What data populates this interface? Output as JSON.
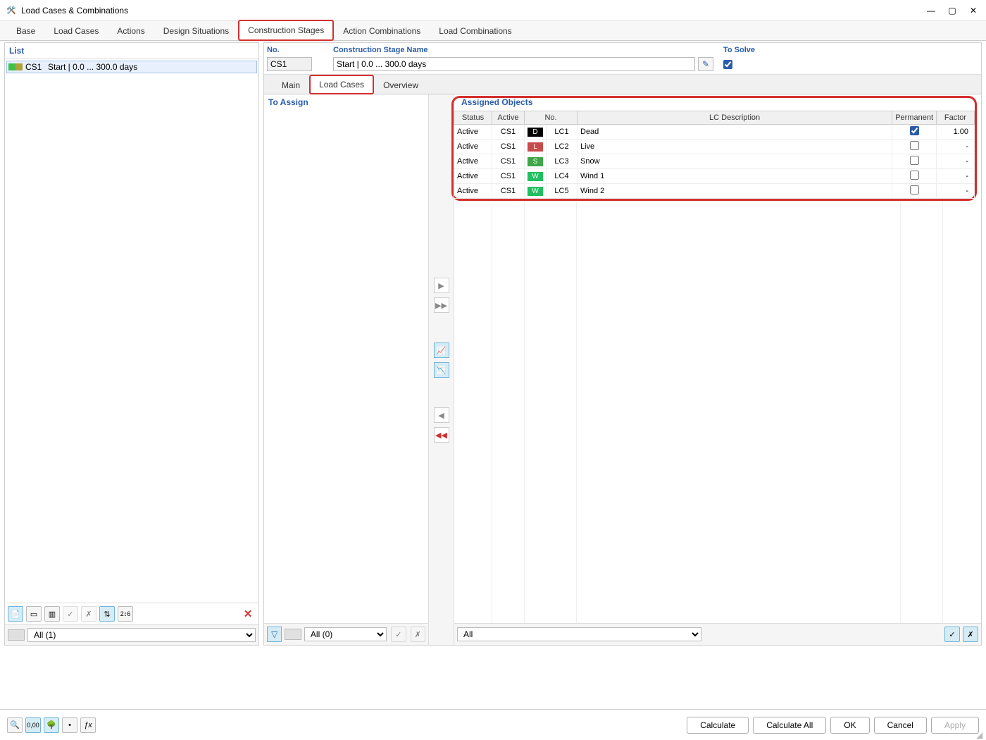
{
  "window": {
    "title": "Load Cases & Combinations"
  },
  "tabs": {
    "base": "Base",
    "load_cases": "Load Cases",
    "actions": "Actions",
    "design_situations": "Design Situations",
    "construction_stages": "Construction Stages",
    "action_combinations": "Action Combinations",
    "load_combinations": "Load Combinations"
  },
  "list": {
    "header": "List",
    "item_id": "CS1",
    "item_name": "Start | 0.0 ... 300.0 days",
    "swatch_colors": [
      "#3fc14a",
      "#b0a23a"
    ],
    "filter_label": "All (1)"
  },
  "detail": {
    "no_label": "No.",
    "no_value": "CS1",
    "name_label": "Construction Stage Name",
    "name_value": "Start | 0.0 ... 300.0 days",
    "solve_label": "To Solve",
    "solve_checked": true
  },
  "subtabs": {
    "main": "Main",
    "load_cases": "Load Cases",
    "overview": "Overview"
  },
  "assign": {
    "header": "To Assign",
    "filter_label": "All (0)"
  },
  "objects": {
    "header": "Assigned Objects",
    "columns": {
      "status": "Status",
      "active": "Active",
      "no": "No.",
      "desc": "LC Description",
      "permanent": "Permanent",
      "factor": "Factor"
    },
    "rows": [
      {
        "status": "Active",
        "active": "CS1",
        "badge": "D",
        "badge_bg": "#000000",
        "no": "LC1",
        "desc": "Dead",
        "permanent": true,
        "factor": "1.00"
      },
      {
        "status": "Active",
        "active": "CS1",
        "badge": "L",
        "badge_bg": "#c84b4b",
        "no": "LC2",
        "desc": "Live",
        "permanent": false,
        "factor": "-"
      },
      {
        "status": "Active",
        "active": "CS1",
        "badge": "S",
        "badge_bg": "#3fa648",
        "no": "LC3",
        "desc": "Snow",
        "permanent": false,
        "factor": "-"
      },
      {
        "status": "Active",
        "active": "CS1",
        "badge": "W",
        "badge_bg": "#20c060",
        "no": "LC4",
        "desc": "Wind 1",
        "permanent": false,
        "factor": "-"
      },
      {
        "status": "Active",
        "active": "CS1",
        "badge": "W",
        "badge_bg": "#20c060",
        "no": "LC5",
        "desc": "Wind 2",
        "permanent": false,
        "factor": "-"
      }
    ],
    "filter_label": "All"
  },
  "buttons": {
    "calculate": "Calculate",
    "calculate_all": "Calculate All",
    "ok": "OK",
    "cancel": "Cancel",
    "apply": "Apply"
  }
}
